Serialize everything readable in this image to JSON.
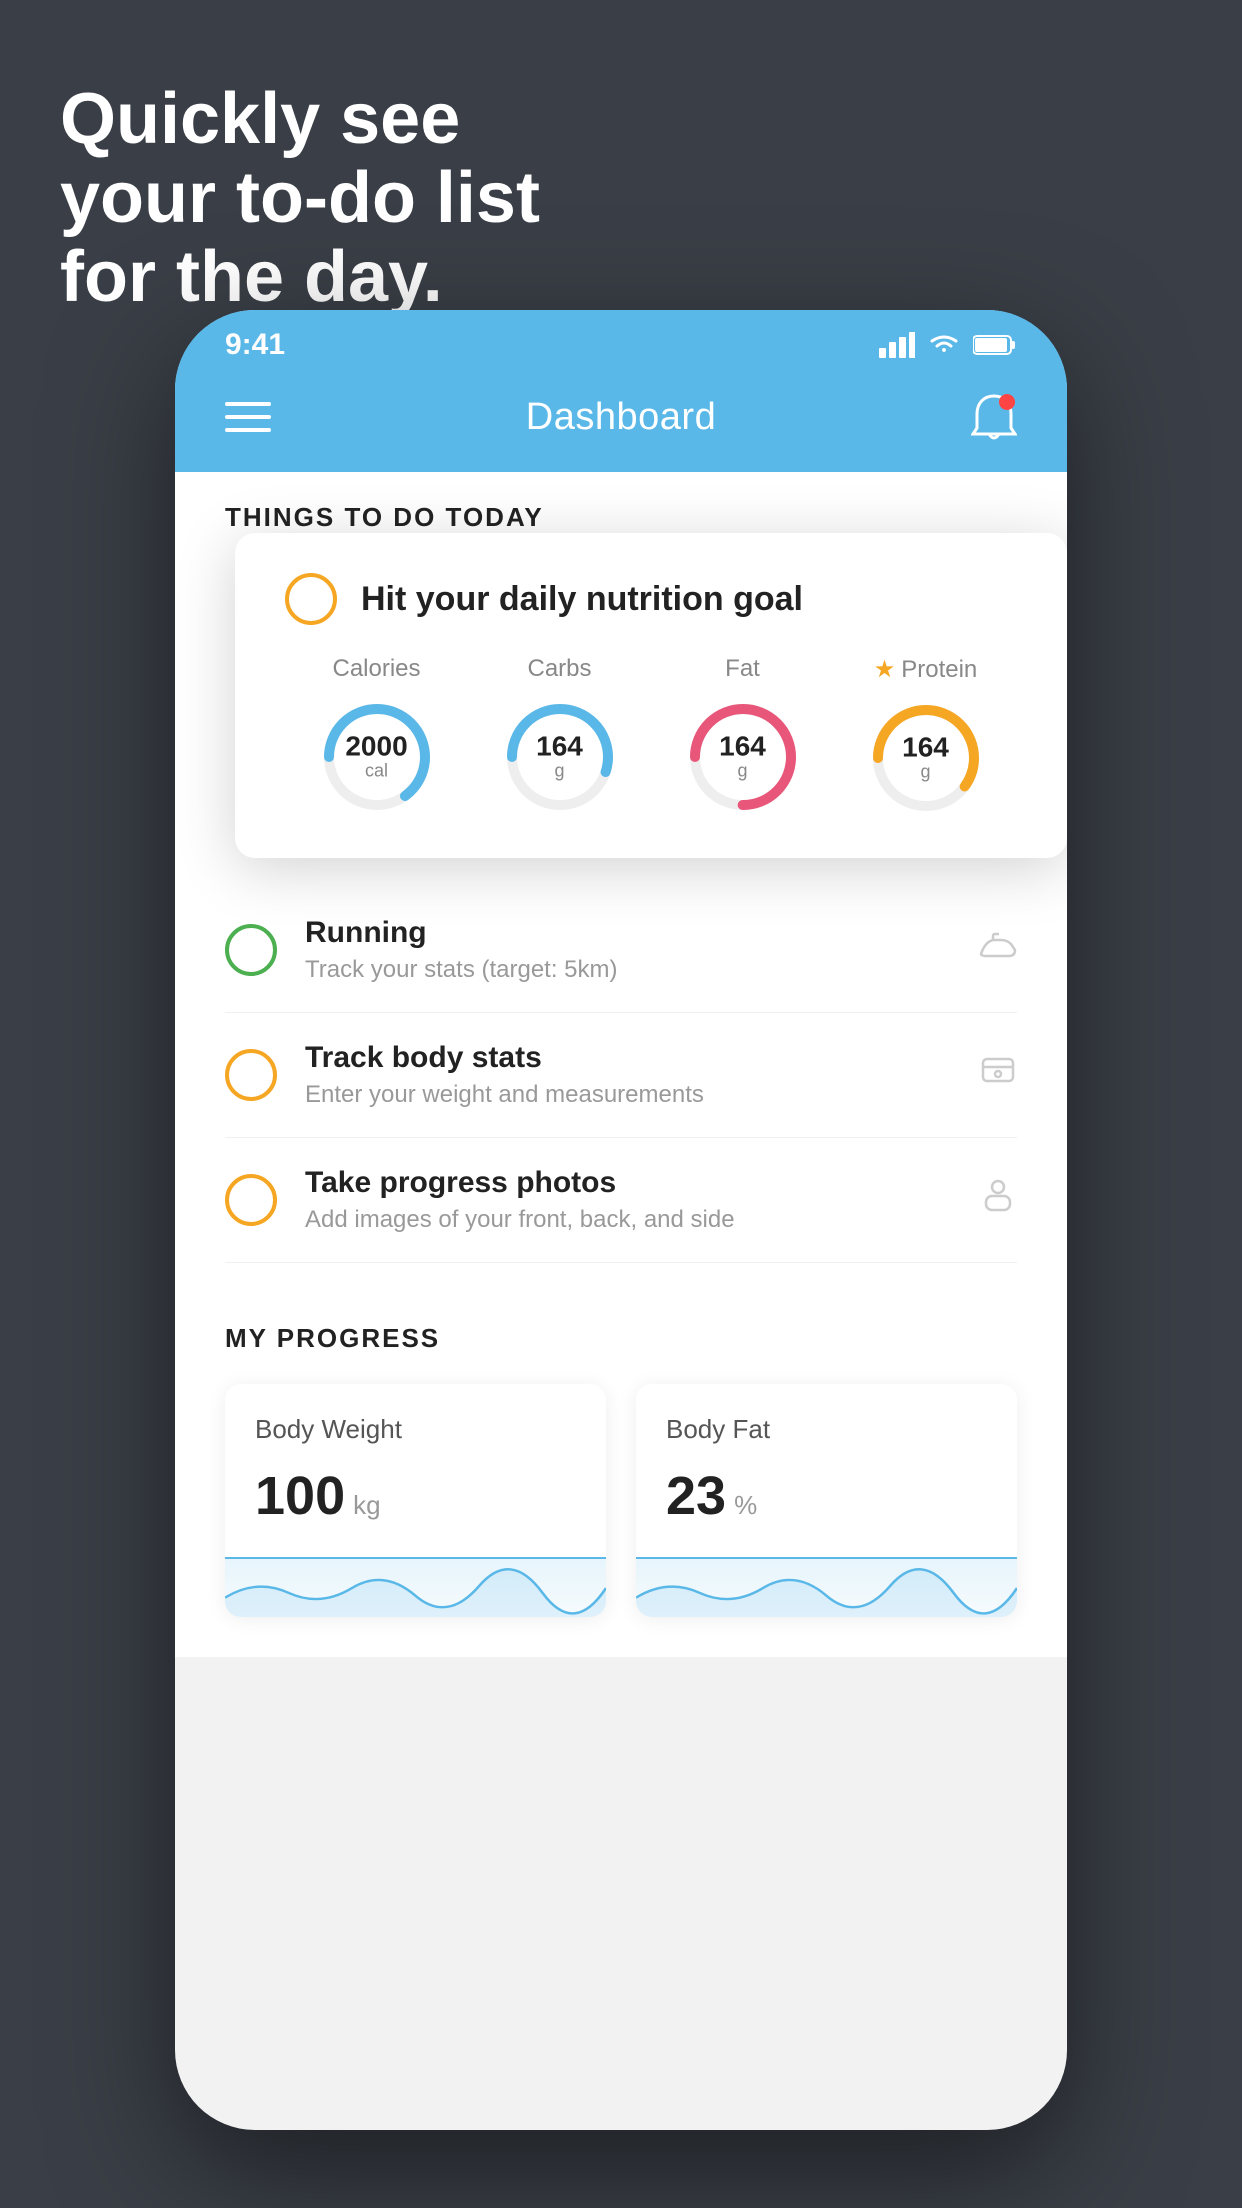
{
  "headline": {
    "line1": "Quickly see",
    "line2": "your to-do list",
    "line3": "for the day."
  },
  "statusBar": {
    "time": "9:41",
    "signal": "▪▪▪▪",
    "wifi": "wifi",
    "battery": "battery"
  },
  "navbar": {
    "title": "Dashboard"
  },
  "sectionHeader": "THINGS TO DO TODAY",
  "floatingCard": {
    "title": "Hit your daily nutrition goal",
    "items": [
      {
        "label": "Calories",
        "value": "2000",
        "unit": "cal",
        "color": "#5ab8e8",
        "percent": 65,
        "starred": false
      },
      {
        "label": "Carbs",
        "value": "164",
        "unit": "g",
        "color": "#5ab8e8",
        "percent": 55,
        "starred": false
      },
      {
        "label": "Fat",
        "value": "164",
        "unit": "g",
        "color": "#e8567a",
        "percent": 75,
        "starred": false
      },
      {
        "label": "Protein",
        "value": "164",
        "unit": "g",
        "color": "#f5a623",
        "percent": 60,
        "starred": true
      }
    ]
  },
  "todoItems": [
    {
      "title": "Running",
      "subtitle": "Track your stats (target: 5km)",
      "circleColor": "green",
      "icon": "shoe"
    },
    {
      "title": "Track body stats",
      "subtitle": "Enter your weight and measurements",
      "circleColor": "yellow",
      "icon": "scale"
    },
    {
      "title": "Take progress photos",
      "subtitle": "Add images of your front, back, and side",
      "circleColor": "yellow",
      "icon": "person"
    }
  ],
  "progressSection": {
    "header": "MY PROGRESS",
    "cards": [
      {
        "title": "Body Weight",
        "value": "100",
        "unit": "kg"
      },
      {
        "title": "Body Fat",
        "value": "23",
        "unit": "%"
      }
    ]
  }
}
